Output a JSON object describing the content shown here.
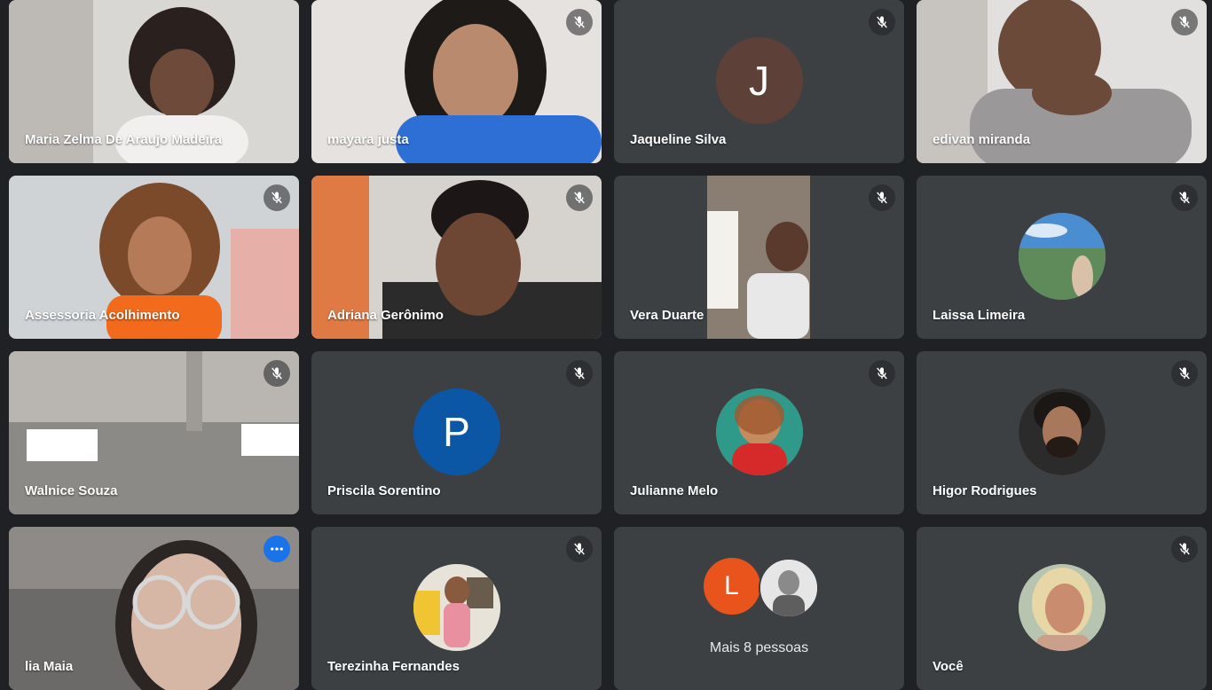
{
  "participants": [
    {
      "name": "Maria Zelma De Araujo Madeira",
      "muted": false,
      "type": "video"
    },
    {
      "name": "mayara justa",
      "muted": true,
      "type": "video"
    },
    {
      "name": "Jaqueline Silva",
      "muted": true,
      "type": "initial",
      "initial": "J",
      "color": "#5d4037"
    },
    {
      "name": "edivan miranda",
      "muted": true,
      "type": "video"
    },
    {
      "name": "Assessoria Acolhimento",
      "muted": true,
      "type": "video"
    },
    {
      "name": "Adriana Gerônimo",
      "muted": true,
      "type": "video"
    },
    {
      "name": "Vera Duarte",
      "muted": true,
      "type": "video"
    },
    {
      "name": "Laissa Limeira",
      "muted": true,
      "type": "photo"
    },
    {
      "name": "Walnice Souza",
      "muted": true,
      "type": "video"
    },
    {
      "name": "Priscila Sorentino",
      "muted": true,
      "type": "initial",
      "initial": "P",
      "color": "#0b57a6"
    },
    {
      "name": "Julianne Melo",
      "muted": true,
      "type": "photo"
    },
    {
      "name": "Higor Rodrigues",
      "muted": true,
      "type": "photo"
    },
    {
      "name": "lia Maia",
      "muted": false,
      "type": "video",
      "active_speaker": true
    },
    {
      "name": "Terezinha Fernandes",
      "muted": true,
      "type": "photo"
    },
    {
      "name": "Você",
      "muted": true,
      "type": "photo"
    }
  ],
  "group_tile": {
    "initial": "L",
    "color": "#e8541c",
    "label": "Mais 8 pessoas"
  },
  "colors": {
    "tile_bg": "#3c4043",
    "page_bg": "#202124",
    "speaker_ring": "#8ab4f8"
  }
}
